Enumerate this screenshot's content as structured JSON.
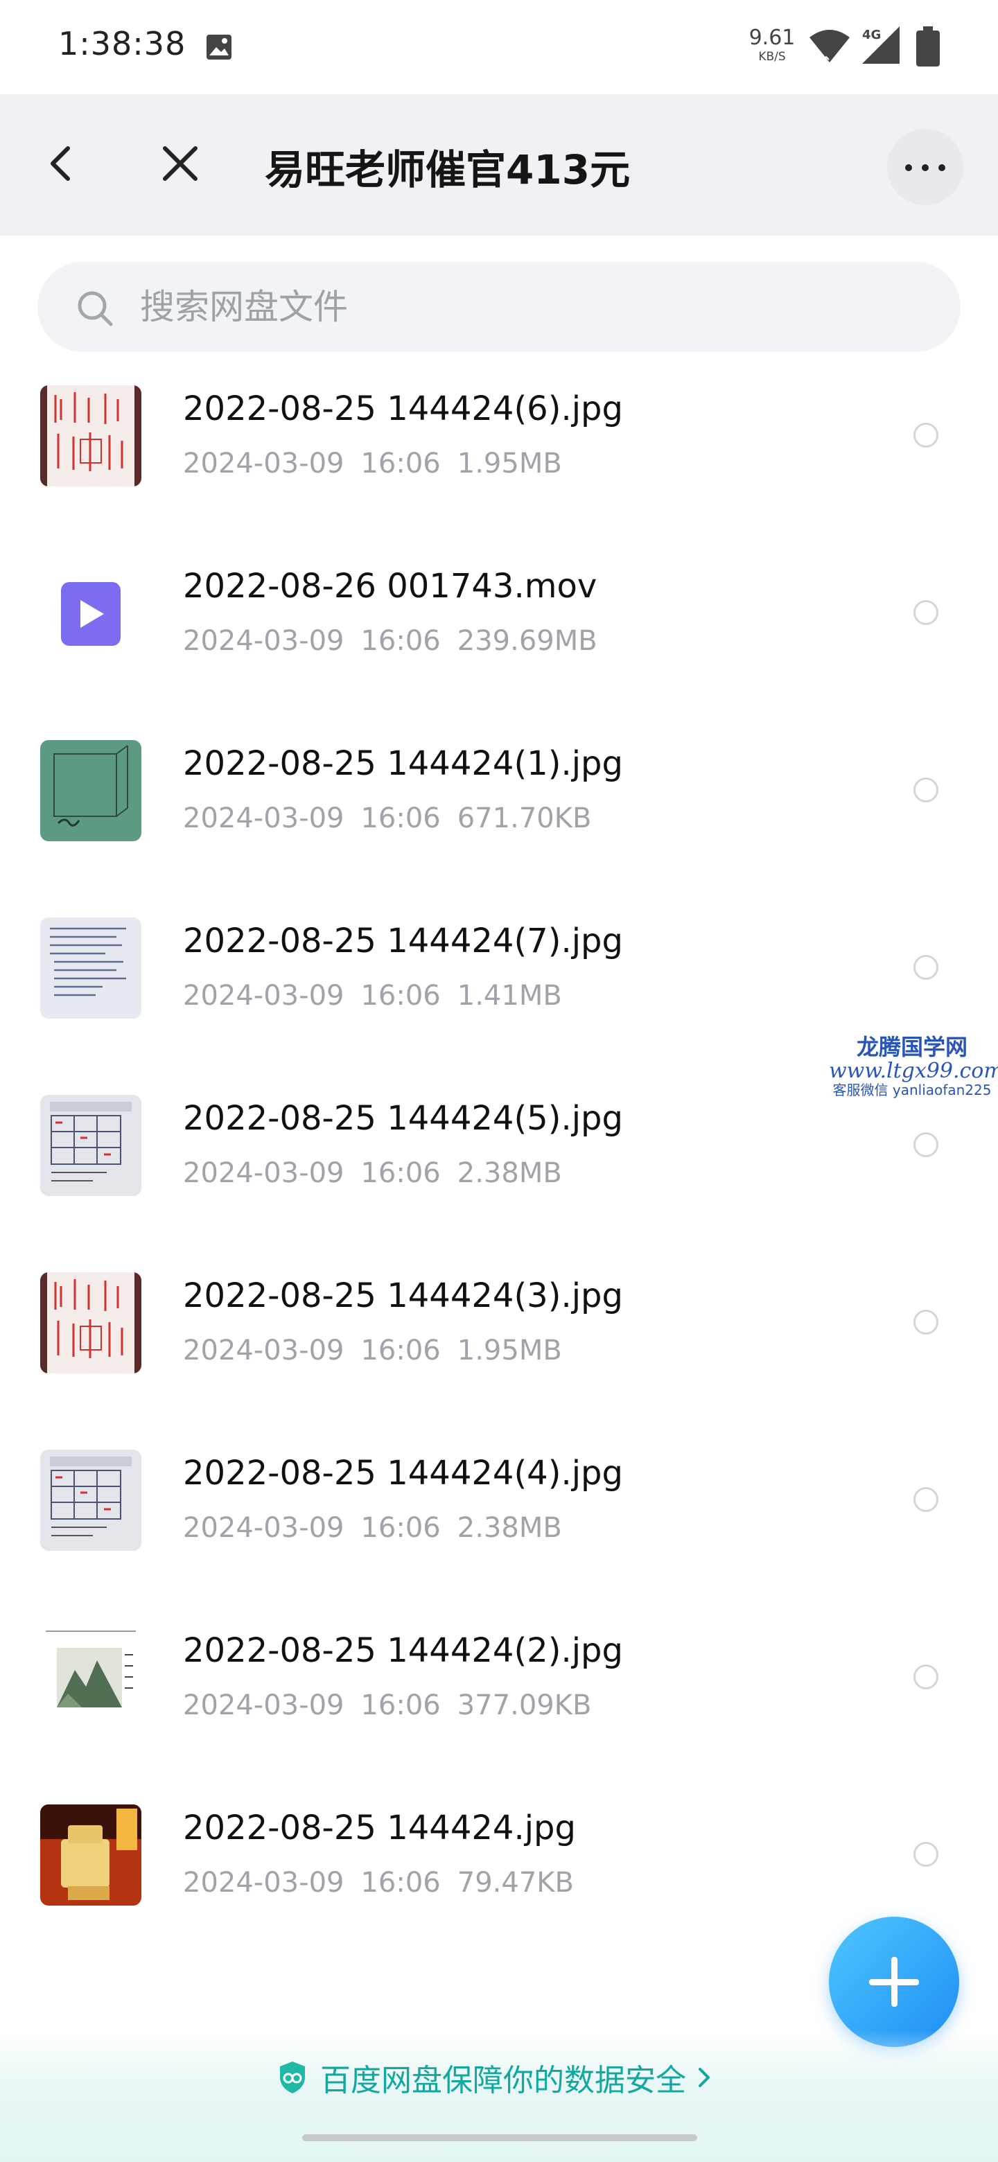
{
  "status_bar": {
    "time": "1:38:38",
    "net_speed_value": "9.61",
    "net_speed_unit": "KB/S",
    "network_type": "4G"
  },
  "header": {
    "title": "易旺老师催官413元",
    "icons": [
      "back-arrow-icon",
      "close-icon",
      "more-icon"
    ]
  },
  "search": {
    "placeholder": "搜索网盘文件"
  },
  "files": [
    {
      "name": "2022-08-25 144424(6).jpg",
      "date": "2024-03-09",
      "time": "16:06",
      "size": "1.95MB",
      "thumb": "red-seal-doc"
    },
    {
      "name": "2022-08-26 001743.mov",
      "date": "2024-03-09",
      "time": "16:06",
      "size": "239.69MB",
      "thumb": "video-icon"
    },
    {
      "name": "2022-08-25 144424(1).jpg",
      "date": "2024-03-09",
      "time": "16:06",
      "size": "671.70KB",
      "thumb": "green-sketch"
    },
    {
      "name": "2022-08-25 144424(7).jpg",
      "date": "2024-03-09",
      "time": "16:06",
      "size": "1.41MB",
      "thumb": "handwritten-notes"
    },
    {
      "name": "2022-08-25 144424(5).jpg",
      "date": "2024-03-09",
      "time": "16:06",
      "size": "2.38MB",
      "thumb": "grid-chart"
    },
    {
      "name": "2022-08-25 144424(3).jpg",
      "date": "2024-03-09",
      "time": "16:06",
      "size": "1.95MB",
      "thumb": "red-seal-doc"
    },
    {
      "name": "2022-08-25 144424(4).jpg",
      "date": "2024-03-09",
      "time": "16:06",
      "size": "2.38MB",
      "thumb": "grid-chart"
    },
    {
      "name": "2022-08-25 144424(2).jpg",
      "date": "2024-03-09",
      "time": "16:06",
      "size": "377.09KB",
      "thumb": "landscape-painting"
    },
    {
      "name": "2022-08-25 144424.jpg",
      "date": "2024-03-09",
      "time": "16:06",
      "size": "79.47KB",
      "thumb": "jade-seal-photo"
    }
  ],
  "watermark": {
    "line1": "龙腾国学网",
    "line2": "www.ltgx99.com",
    "line3": "客服微信 yanliaofan225"
  },
  "fab": {
    "icon": "plus-icon"
  },
  "footer": {
    "safety_text": "百度网盘保障你的数据安全",
    "accent_color": "#12a8a0"
  },
  "colors": {
    "fab_gradient_start": "#4ec6ff",
    "fab_gradient_end": "#1f8ef4",
    "topbar_bg": "#f0f1f5",
    "meta_text": "#a0a3a9"
  }
}
